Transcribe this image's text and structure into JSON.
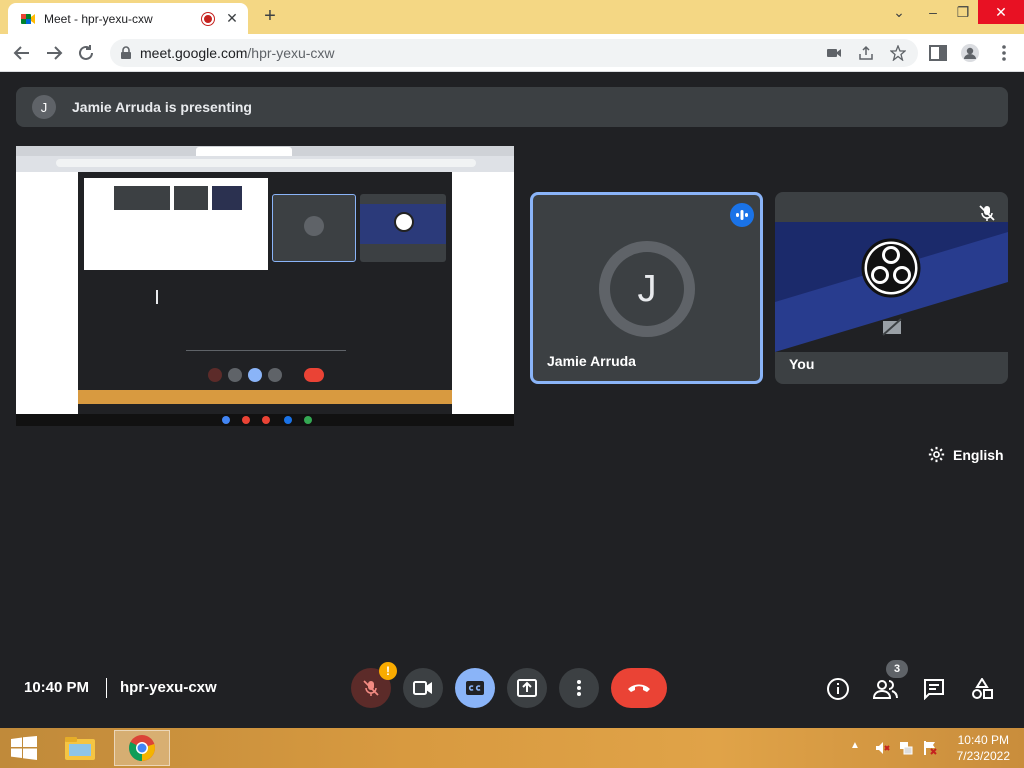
{
  "browser": {
    "tab_title": "Meet - hpr-yexu-cxw",
    "url_domain": "meet.google.com",
    "url_path": "/hpr-yexu-cxw",
    "newtab_label": "+"
  },
  "meet": {
    "presenting_avatar": "J",
    "presenting_text": "Jamie Arruda is presenting",
    "participants": [
      {
        "name": "Jamie Arruda",
        "avatar": "J",
        "speaking": true
      },
      {
        "name": "You",
        "muted": true
      }
    ],
    "caption_language": "English",
    "time": "10:40 PM",
    "meeting_code": "hpr-yexu-cxw",
    "mic_warning": "!",
    "people_count": "3",
    "colors": {
      "accent": "#8ab4f8",
      "end_call": "#ea4335",
      "warning": "#f9ab00"
    }
  },
  "taskbar": {
    "clock_time": "10:40 PM",
    "clock_date": "7/23/2022"
  }
}
